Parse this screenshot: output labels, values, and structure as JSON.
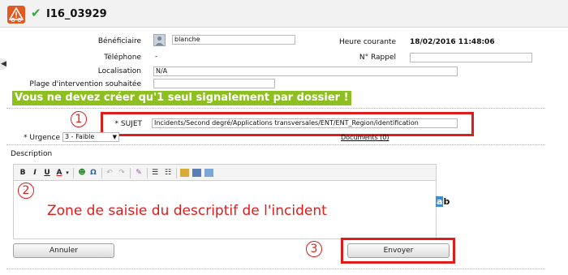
{
  "header": {
    "ticket_id": "I16_03929",
    "logo_icon": "warning-glasses-icon",
    "status_icon": "check-icon"
  },
  "form": {
    "beneficiary_label": "Bénéficiaire",
    "beneficiary_value": "blanche",
    "phone_label": "Téléphone",
    "phone_value": "-",
    "location_label": "Localisation",
    "location_value": "N/A",
    "intervention_label": "Plage d'intervention souhaitée",
    "intervention_value": "",
    "current_time_label": "Heure courante",
    "current_time_value": "18/02/2016 11:48:06",
    "callback_label": "N° Rappel",
    "callback_value": "",
    "warning_text": "Vous ne devez créer qu'1 seul signalement par dossier !",
    "subject_label": "* SUJET",
    "subject_value": "Incidents/Second degré/Applications transversales/ENT/ENT_Region/identification",
    "urgency_label": "* Urgence",
    "urgency_value": "3 - Faible",
    "documents_link": "Documents (0)",
    "description_label": "Description",
    "editor_placeholder": "Zone de saisie du descriptif de l'incident",
    "ab_icon_a": "a",
    "ab_icon_b": "b"
  },
  "annotations": [
    "1",
    "2",
    "3"
  ],
  "toolbar": {
    "bold": "B",
    "italic": "I",
    "underline": "U",
    "font_color": "A",
    "omega": "Ω"
  },
  "buttons": {
    "cancel": "Annuler",
    "send": "Envoyer"
  },
  "colors": {
    "accent_orange": "#e4571f",
    "warning_green": "#8cbf1f",
    "annotation_red": "#e01b1b",
    "check_green": "#3aa53a"
  }
}
